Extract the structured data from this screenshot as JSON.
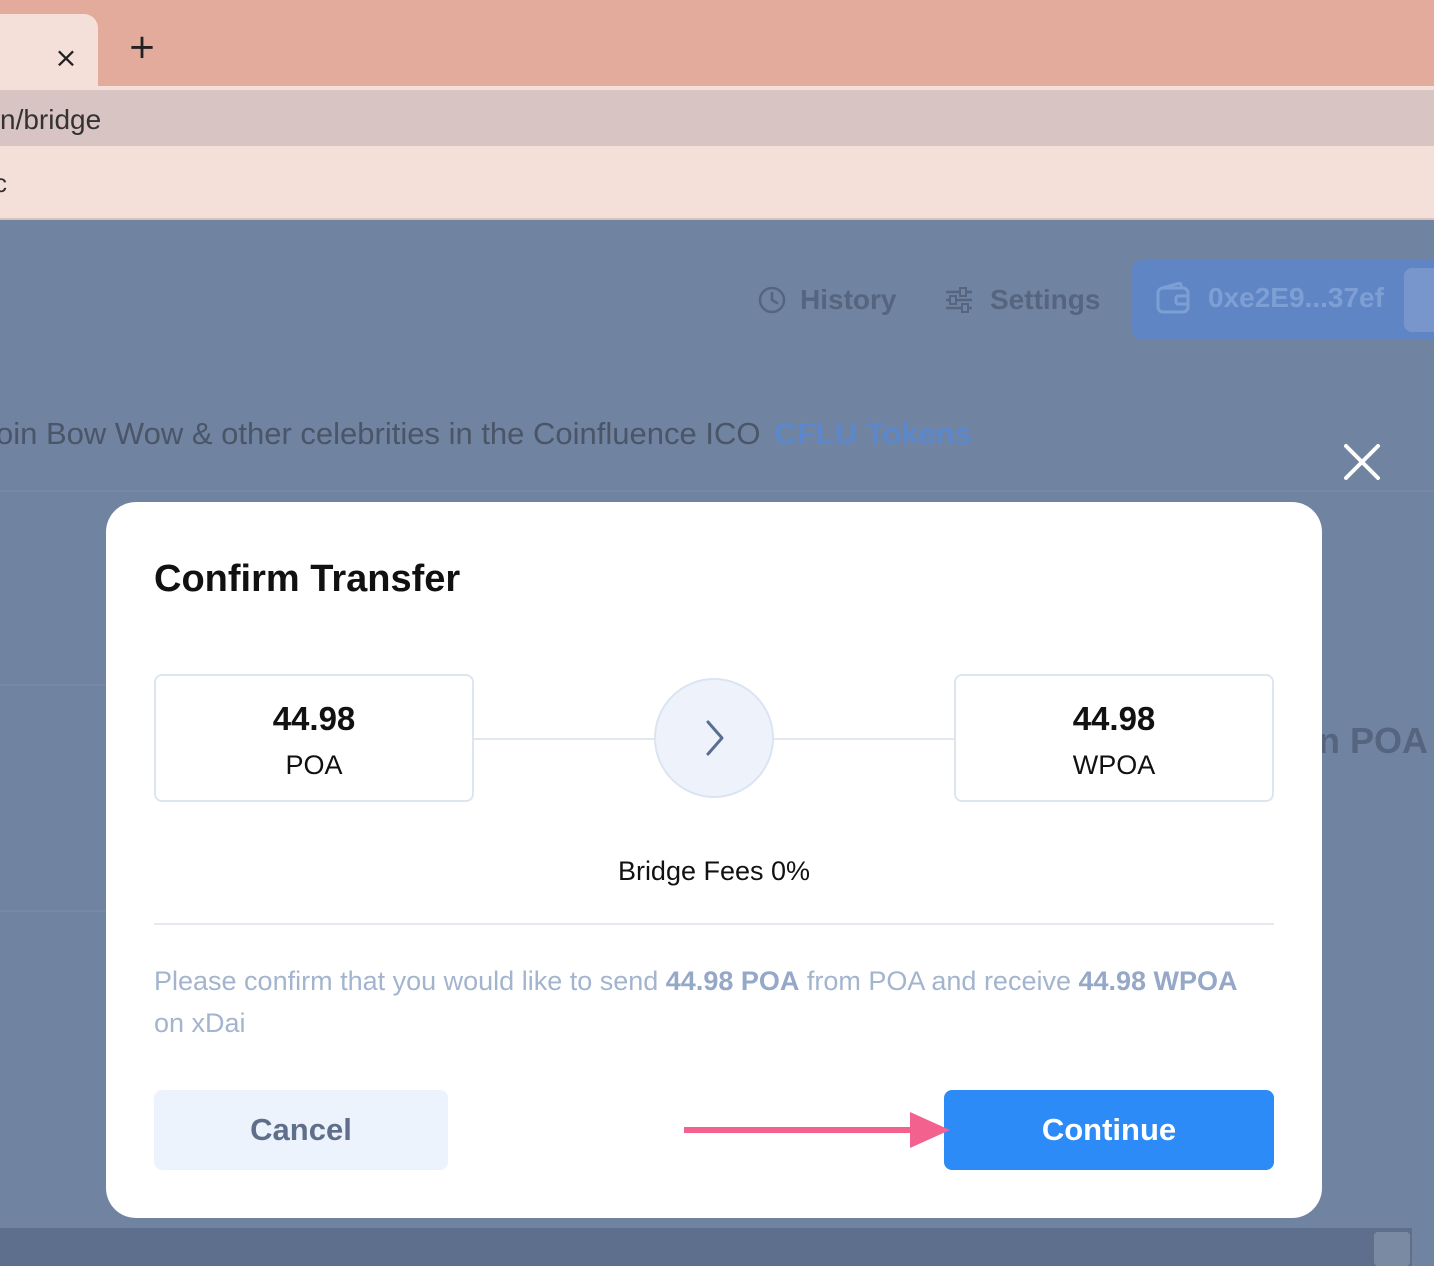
{
  "browser": {
    "tab_close_icon": "×",
    "new_tab_icon": "+",
    "url": "n/bridge",
    "bookmark_fragment": "c"
  },
  "header": {
    "history_label": "History",
    "settings_label": "Settings",
    "wallet_address": "0xe2E9...37ef"
  },
  "banner": {
    "text": "oin Bow Wow & other celebrities in the Coinfluence ICO",
    "link": "CFLU Tokens"
  },
  "background": {
    "partial_text": "n POA"
  },
  "modal": {
    "title": "Confirm Transfer",
    "from": {
      "amount": "44.98",
      "symbol": "POA"
    },
    "to": {
      "amount": "44.98",
      "symbol": "WPOA"
    },
    "fees": "Bridge Fees 0%",
    "confirm": {
      "prefix": "Please confirm that you would like to send ",
      "send_amount": "44.98 POA",
      "middle": " from POA and receive ",
      "receive_amount": "44.98 WPOA",
      "suffix": " on xDai"
    },
    "cancel_label": "Cancel",
    "continue_label": "Continue"
  },
  "colors": {
    "overlay": "#7083a0",
    "primary": "#2c8bf6",
    "annotation_arrow": "#f3628f",
    "tabbar": "#e3ab9b"
  }
}
